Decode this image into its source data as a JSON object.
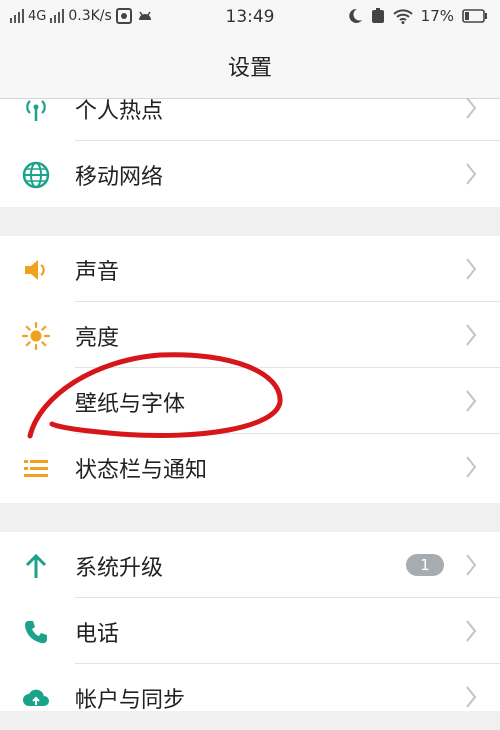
{
  "status_bar": {
    "network": "4G",
    "speed": "0.3K/s",
    "time": "13:49",
    "battery": "17%"
  },
  "header": {
    "title": "设置"
  },
  "groups": [
    {
      "items": [
        {
          "label": "个人热点",
          "icon": "hotspot-icon"
        },
        {
          "label": "移动网络",
          "icon": "globe-icon"
        }
      ]
    },
    {
      "items": [
        {
          "label": "声音",
          "icon": "speaker-icon"
        },
        {
          "label": "亮度",
          "icon": "sun-icon"
        },
        {
          "label": "壁纸与字体",
          "icon": "wallpaper-icon"
        },
        {
          "label": "状态栏与通知",
          "icon": "notification-icon"
        }
      ]
    },
    {
      "items": [
        {
          "label": "系统升级",
          "icon": "upgrade-arrow-icon",
          "badge": "1"
        },
        {
          "label": "电话",
          "icon": "phone-icon"
        },
        {
          "label": "帐户与同步",
          "icon": "cloud-sync-icon"
        }
      ]
    }
  ],
  "colors": {
    "accent_orange": "#f2a11c",
    "accent_teal": "#1ba38a",
    "annotation_red": "#d6161a"
  }
}
